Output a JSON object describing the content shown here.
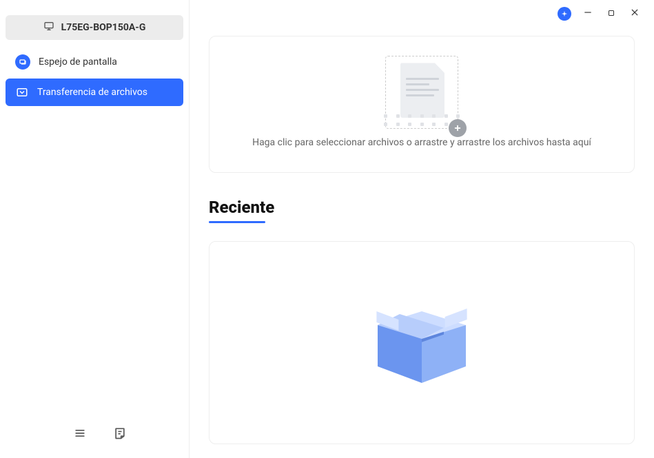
{
  "device": {
    "name": "L75EG-BOP150A-G"
  },
  "sidebar": {
    "items": [
      {
        "label": "Espejo de pantalla"
      },
      {
        "label": "Transferencia de archivos"
      }
    ]
  },
  "main": {
    "drop_text": "Haga clic para seleccionar archivos o arrastre y arrastre los archivos hasta aquí",
    "recent_heading": "Reciente"
  }
}
